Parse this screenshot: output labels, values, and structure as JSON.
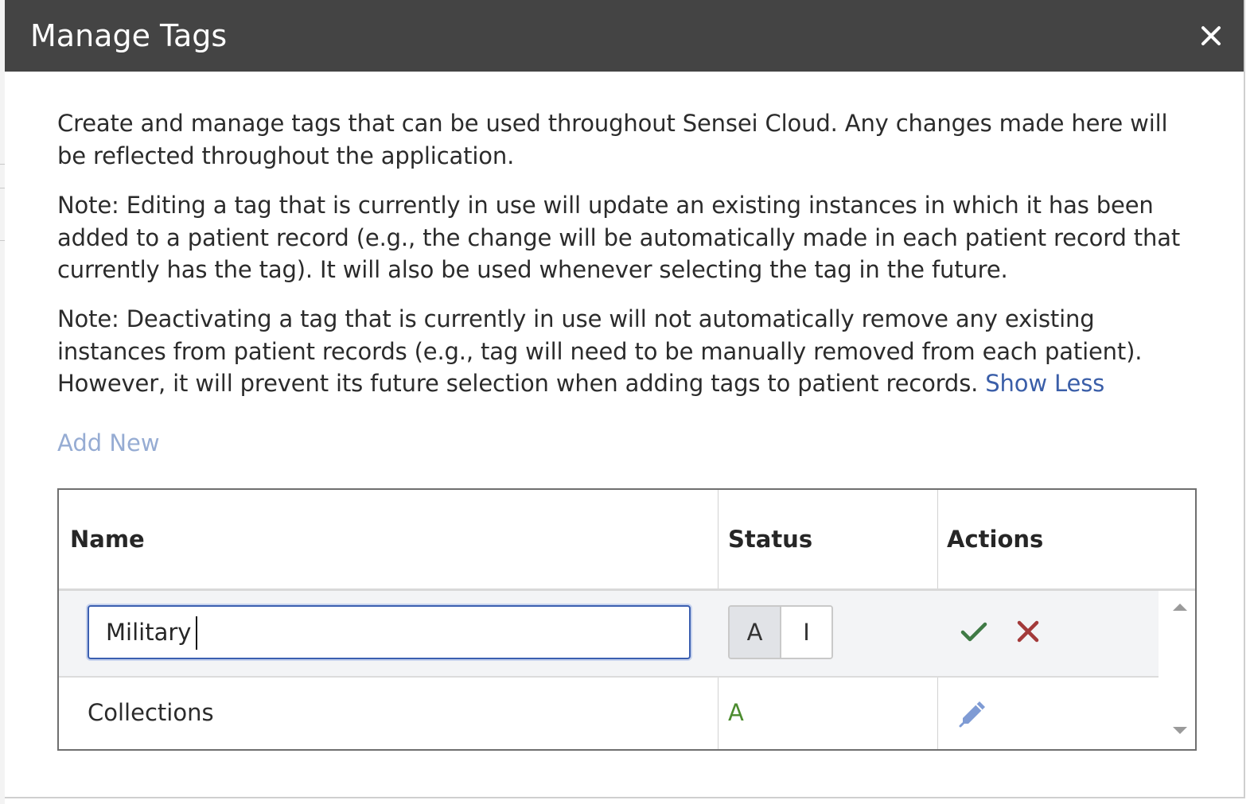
{
  "dialog": {
    "title": "Manage Tags",
    "close_icon": "close-icon"
  },
  "description": {
    "paragraph1": "Create and manage tags that can be used throughout Sensei Cloud. Any changes made here will be reflected throughout the application.",
    "paragraph2": "Note: Editing a tag that is currently in use will update an existing instances in which it has been added to a patient record (e.g., the change will be automatically made in each patient record that currently has the tag). It will also be used whenever selecting the tag in the future.",
    "paragraph3": "Note: Deactivating a tag that is currently in use will not automatically remove any existing instances from patient records (e.g., tag will need to be manually removed from each patient). However, it will prevent its future selection when adding tags to patient records.",
    "show_less": "Show Less"
  },
  "add_new_label": "Add New",
  "table": {
    "columns": [
      "Name",
      "Status",
      "Actions"
    ],
    "edit_row": {
      "name_value": "Military",
      "status_options": [
        "A",
        "I"
      ],
      "selected_status": "A",
      "actions": [
        "check-icon",
        "x-icon"
      ]
    },
    "rows": [
      {
        "name": "Collections",
        "status": "A",
        "action": "pencil-icon"
      }
    ]
  },
  "colors": {
    "header_bg": "#444444",
    "link": "#3a5ea8",
    "add_new": "#96acd3",
    "active_status": "#4c8c2f",
    "confirm": "#3f7a45",
    "cancel": "#a33a3a"
  }
}
